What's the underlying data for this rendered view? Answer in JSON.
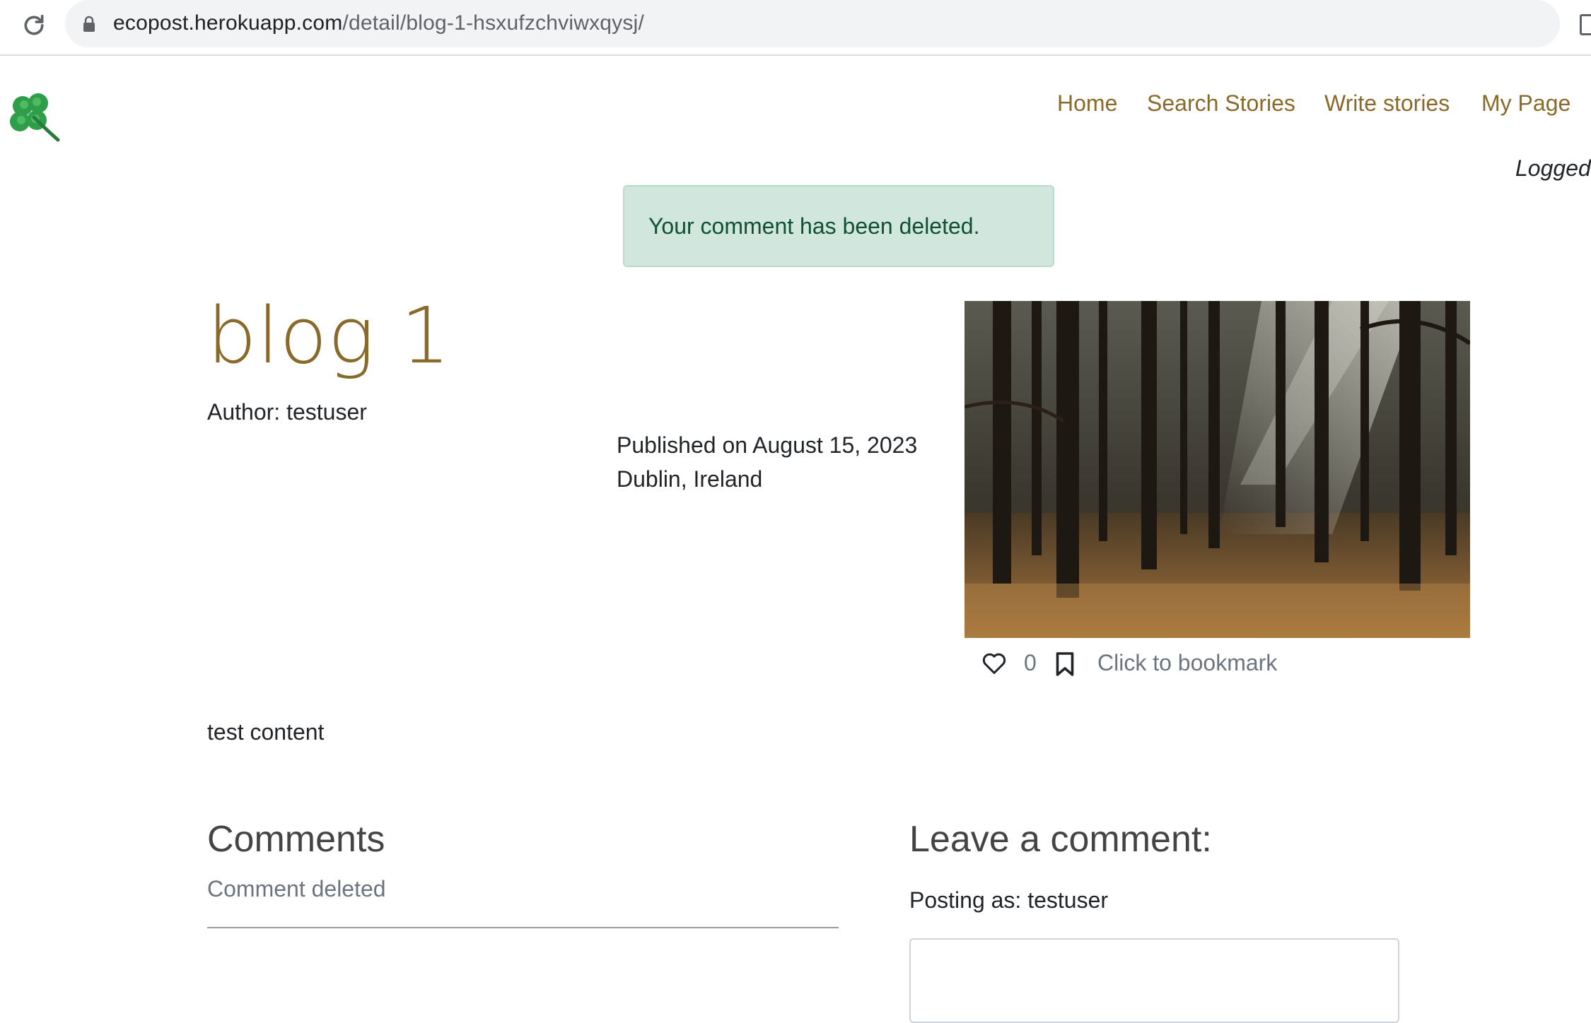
{
  "browser": {
    "url_domain": "ecopost.herokuapp.com",
    "url_path": "/detail/blog-1-hsxufzchviwxqysj/"
  },
  "nav": {
    "items": [
      {
        "label": "Home"
      },
      {
        "label": "Search Stories"
      },
      {
        "label": "Write stories"
      },
      {
        "label": "My Page"
      }
    ],
    "logged_label": "Logged"
  },
  "alert": {
    "message": "Your comment has been deleted."
  },
  "post": {
    "title": "blog 1",
    "author": "Author: testuser",
    "published": "Published on August 15, 2023",
    "location": "Dublin, Ireland",
    "likes": "0",
    "bookmark_label": "Click to bookmark",
    "content": "test content"
  },
  "comments": {
    "heading": "Comments",
    "items": [
      {
        "text": "Comment deleted"
      }
    ]
  },
  "comment_form": {
    "heading": "Leave a comment:",
    "posting_as": "Posting as: testuser",
    "textarea_value": ""
  },
  "colors": {
    "brand": "#8a6a2a",
    "alert_bg": "#d1e7dd",
    "alert_text": "#0f5132",
    "muted": "#6c757d"
  },
  "icons": {
    "reload": "reload-icon",
    "lock": "lock-icon",
    "logo": "four-leaf-clover-icon",
    "like": "heart-icon",
    "bookmark": "bookmark-icon"
  }
}
